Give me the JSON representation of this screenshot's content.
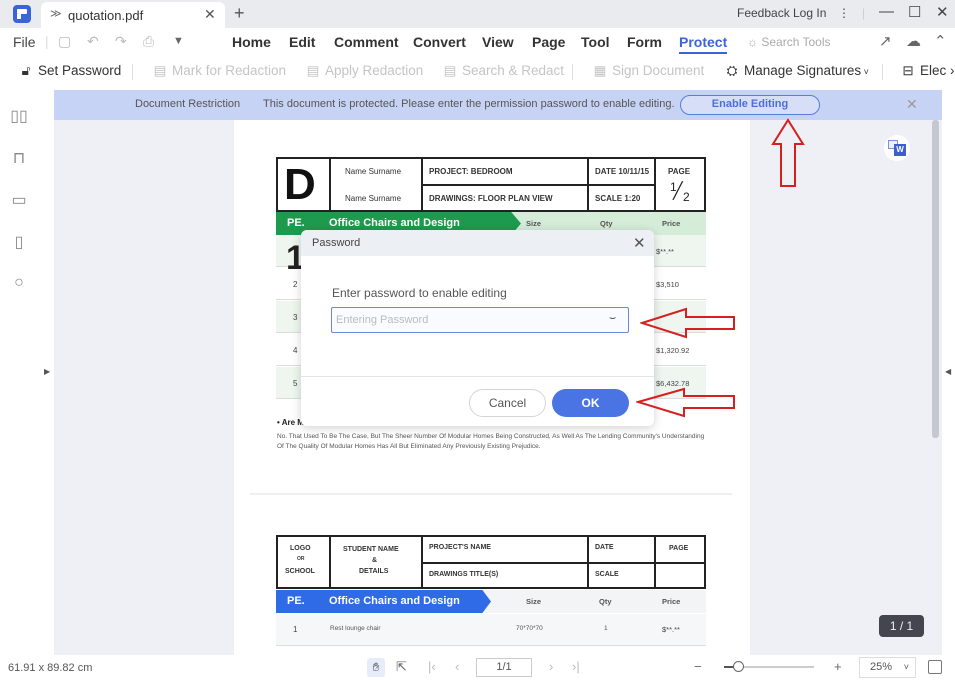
{
  "titlebar": {
    "tab_title": "quotation.pdf",
    "feedback": "Feedback",
    "login": "Log In"
  },
  "menubar": {
    "file": "File",
    "tabs": [
      "Home",
      "Edit",
      "Comment",
      "Convert",
      "View",
      "Page",
      "Tool",
      "Form",
      "Protect"
    ],
    "active_tab": "Protect",
    "search_tools": "Search Tools"
  },
  "toolbar": {
    "set_password": "Set Password",
    "mark_for_redaction": "Mark for Redaction",
    "apply_redaction": "Apply Redaction",
    "search_redact": "Search & Redact",
    "sign_document": "Sign Document",
    "manage_signatures": "Manage Signatures",
    "electronic": "Elec"
  },
  "banner": {
    "label": "Document Restriction",
    "message": "This document is protected. Please enter the permission password to enable editing.",
    "button": "Enable Editing"
  },
  "document": {
    "page1": {
      "logo_letter": "D",
      "names": [
        "Name Surname",
        "Name Surname"
      ],
      "project": "PROJECT: BEDROOM",
      "drawings": "DRAWINGS: FLOOR PLAN VIEW",
      "date": "DATE 10/11/15",
      "scale": "SCALE 1:20",
      "page_label": "PAGE",
      "page_num": "1",
      "page_den": "2",
      "band_tag": "PE.",
      "band_title": "Office Chairs and Design",
      "col_size": "Size",
      "col_qty": "Qty",
      "col_price": "Price",
      "rows": [
        {
          "num": "1",
          "price": "$**.**"
        },
        {
          "num": "2",
          "price": "$3,510"
        },
        {
          "num": "3",
          "price": ""
        },
        {
          "num": "4",
          "price": "$1,320.92"
        },
        {
          "num": "5",
          "price": "$6,432.78"
        }
      ],
      "para_head": "• Are M",
      "paragraph": "No. That Used To Be The Case, But The Sheer Number Of Modular Homes Being Constructed, As Well As The Lending Community's Understanding Of The Quality Of Modular Homes Has All But Eliminated Any Previously Existing Prejudice."
    },
    "page2": {
      "logo_lines": [
        "LOGO",
        "OR",
        "SCHOOL"
      ],
      "student_lines": [
        "STUDENT NAME",
        "&",
        "DETAILS"
      ],
      "project": "PROJECT'S NAME",
      "drawings": "DRAWINGS TITLE(S)",
      "date": "DATE",
      "scale": "SCALE",
      "page_label": "PAGE",
      "band_tag": "PE.",
      "band_title": "Office Chairs and Design",
      "col_size": "Size",
      "col_qty": "Qty",
      "col_price": "Price",
      "row1": {
        "num": "1",
        "name": "Rest lounge chair",
        "size": "70*70*70",
        "qty": "1",
        "price": "$**.**"
      }
    }
  },
  "dialog": {
    "title": "Password",
    "label": "Enter password to enable editing",
    "input_value": "",
    "input_placeholder": "Entering Password",
    "cancel": "Cancel",
    "ok": "OK"
  },
  "statusbar": {
    "dimensions": "61.91 x 89.82 cm",
    "page_input": "1/1",
    "zoom_value": "25%",
    "zoom_slider_fraction": 0.15
  },
  "page_badge": "1 / 1",
  "colors": {
    "accent": "#3d63d9",
    "banner_bg": "#c7d3f5",
    "green_band": "#1e9a4e",
    "blue_band": "#2f6be6",
    "annotation_red": "#d62020"
  }
}
